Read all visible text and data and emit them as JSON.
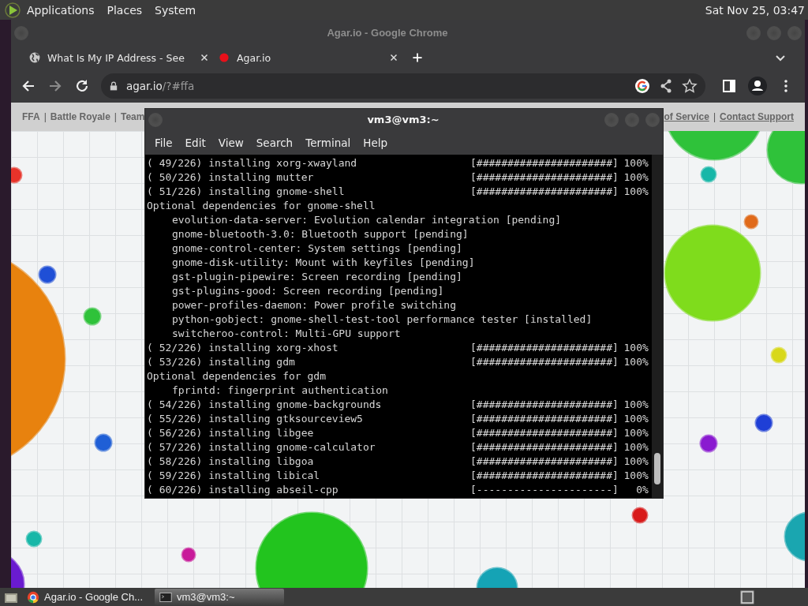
{
  "top_panel": {
    "menus": [
      "Applications",
      "Places",
      "System"
    ],
    "clock": "Sat Nov 25, 03:47"
  },
  "browser": {
    "title": "Agar.io - Google Chrome",
    "tabs": [
      {
        "label": "What Is My IP Address - See",
        "kind": "globe"
      },
      {
        "label": "Agar.io",
        "kind": "dot"
      }
    ],
    "url": {
      "host": "agar.io",
      "path": "/?#ffa"
    },
    "page_nav_left": [
      {
        "kind": "link",
        "text": "FFA"
      },
      {
        "kind": "sep",
        "text": "|"
      },
      {
        "kind": "link",
        "text": "Battle Royale"
      },
      {
        "kind": "sep",
        "text": "|"
      },
      {
        "kind": "link",
        "text": "Team"
      }
    ],
    "page_nav_right": [
      {
        "kind": "link",
        "text": "of Service"
      },
      {
        "kind": "sep",
        "text": "|"
      },
      {
        "kind": "link",
        "text": "Contact Support"
      }
    ]
  },
  "terminal": {
    "title": "vm3@vm3:~",
    "menus": [
      "File",
      "Edit",
      "View",
      "Search",
      "Terminal",
      "Help"
    ],
    "lines": [
      {
        "kind": "install",
        "text": "( 49/226) installing xorg-xwayland",
        "bar": "[######################]",
        "percent": "100%"
      },
      {
        "kind": "install",
        "text": "( 50/226) installing mutter",
        "bar": "[######################]",
        "percent": "100%"
      },
      {
        "kind": "install",
        "text": "( 51/226) installing gnome-shell",
        "bar": "[######################]",
        "percent": "100%"
      },
      {
        "kind": "header",
        "text": "Optional dependencies for gnome-shell"
      },
      {
        "kind": "dep",
        "text": "evolution-data-server: Evolution calendar integration [pending]"
      },
      {
        "kind": "dep",
        "text": "gnome-bluetooth-3.0: Bluetooth support [pending]"
      },
      {
        "kind": "dep",
        "text": "gnome-control-center: System settings [pending]"
      },
      {
        "kind": "dep",
        "text": "gnome-disk-utility: Mount with keyfiles [pending]"
      },
      {
        "kind": "dep",
        "text": "gst-plugin-pipewire: Screen recording [pending]"
      },
      {
        "kind": "dep",
        "text": "gst-plugins-good: Screen recording [pending]"
      },
      {
        "kind": "dep",
        "text": "power-profiles-daemon: Power profile switching"
      },
      {
        "kind": "dep",
        "text": "python-gobject: gnome-shell-test-tool performance tester [installed]"
      },
      {
        "kind": "dep",
        "text": "switcheroo-control: Multi-GPU support"
      },
      {
        "kind": "install",
        "text": "( 52/226) installing xorg-xhost",
        "bar": "[######################]",
        "percent": "100%"
      },
      {
        "kind": "install",
        "text": "( 53/226) installing gdm",
        "bar": "[######################]",
        "percent": "100%"
      },
      {
        "kind": "header",
        "text": "Optional dependencies for gdm"
      },
      {
        "kind": "dep",
        "text": "fprintd: fingerprint authentication"
      },
      {
        "kind": "install",
        "text": "( 54/226) installing gnome-backgrounds",
        "bar": "[######################]",
        "percent": "100%"
      },
      {
        "kind": "install",
        "text": "( 55/226) installing gtksourceview5",
        "bar": "[######################]",
        "percent": "100%"
      },
      {
        "kind": "install",
        "text": "( 56/226) installing libgee",
        "bar": "[######################]",
        "percent": "100%"
      },
      {
        "kind": "install",
        "text": "( 57/226) installing gnome-calculator",
        "bar": "[######################]",
        "percent": "100%"
      },
      {
        "kind": "install",
        "text": "( 58/226) installing libgoa",
        "bar": "[######################]",
        "percent": "100%"
      },
      {
        "kind": "install",
        "text": "( 59/226) installing libical",
        "bar": "[######################]",
        "percent": "100%"
      },
      {
        "kind": "install",
        "text": "( 60/226) installing abseil-cpp",
        "bar": "[----------------------]",
        "percent": "0%"
      }
    ]
  },
  "taskbar": {
    "items": [
      {
        "label": "Agar.io - Google Ch...",
        "kind": "browser",
        "selected": false
      },
      {
        "label": "vm3@vm3:~",
        "kind": "terminal",
        "selected": true
      }
    ]
  }
}
